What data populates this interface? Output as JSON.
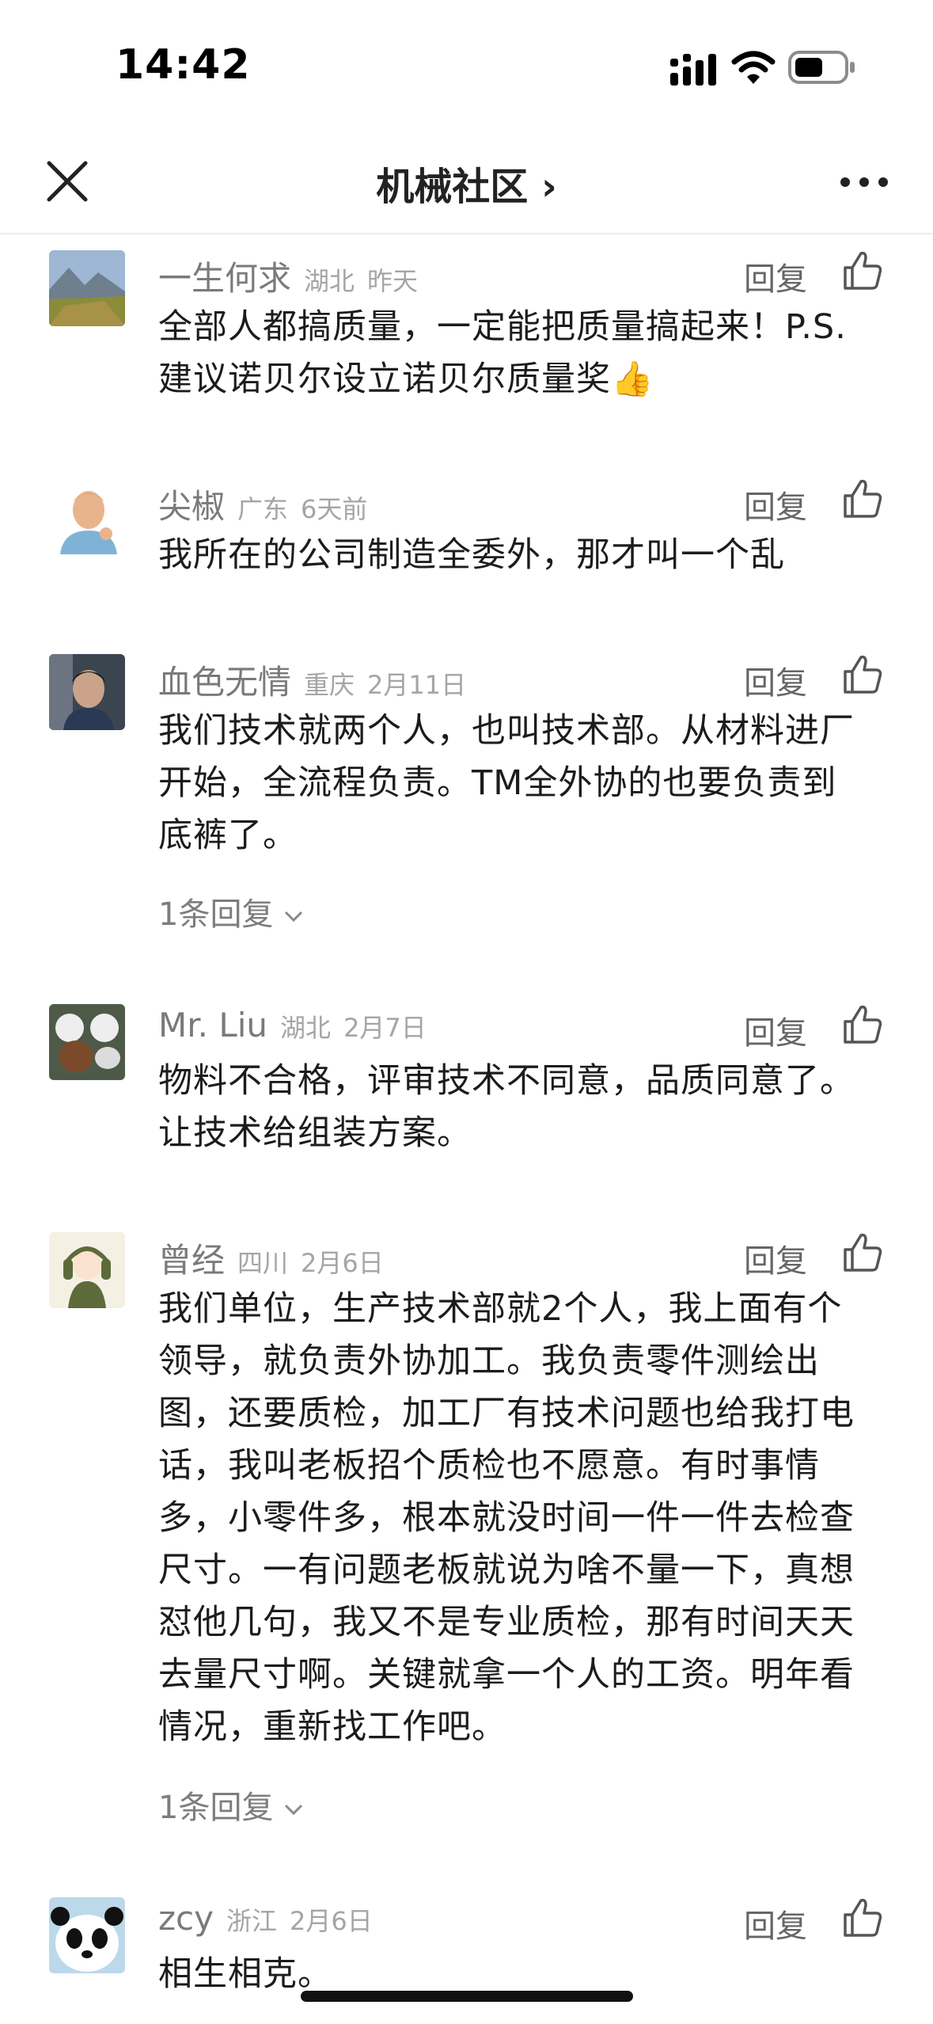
{
  "status_bar": {
    "time": "14:42"
  },
  "nav": {
    "title": "机械社区 ›"
  },
  "comments": [
    {
      "username": "一生何求",
      "location": "湖北",
      "date": "昨天",
      "reply_label": "回复",
      "lines": [
        "全部人都搞质量，一定能把质量搞起来！P.S.",
        "建议诺贝尔设立诺贝尔质量奖👍"
      ]
    },
    {
      "username": "尖椒",
      "location": "广东",
      "date": "6天前",
      "reply_label": "回复",
      "lines": [
        "我所在的公司制造全委外，那才叫一个乱"
      ]
    },
    {
      "username": "血色无情",
      "location": "重庆",
      "date": "2月11日",
      "reply_label": "回复",
      "lines": [
        "我们技术就两个人，也叫技术部。从材料进厂",
        "开始，全流程负责。TM全外协的也要负责到",
        "底裤了。"
      ],
      "replies": "1条回复"
    },
    {
      "username": "Mr. Liu",
      "location": "湖北",
      "date": "2月7日",
      "reply_label": "回复",
      "lines": [
        "物料不合格，评审技术不同意，品质同意了。",
        "让技术给组装方案。"
      ]
    },
    {
      "username": "曾经",
      "location": "四川",
      "date": "2月6日",
      "reply_label": "回复",
      "lines": [
        "我们单位，生产技术部就2个人，我上面有个",
        "领导，就负责外协加工。我负责零件测绘出",
        "图，还要质检，加工厂有技术问题也给我打电",
        "话，我叫老板招个质检也不愿意。有时事情",
        "多，小零件多，根本就没时间一件一件去检查",
        "尺寸。一有问题老板就说为啥不量一下，真想",
        "怼他几句，我又不是专业质检，那有时间天天",
        "去量尺寸啊。关键就拿一个人的工资。明年看",
        "情况，重新找工作吧。"
      ],
      "replies": "1条回复"
    },
    {
      "username": "zcy",
      "location": "浙江",
      "date": "2月6日",
      "reply_label": "回复",
      "lines": [
        "相生相克。"
      ]
    }
  ]
}
